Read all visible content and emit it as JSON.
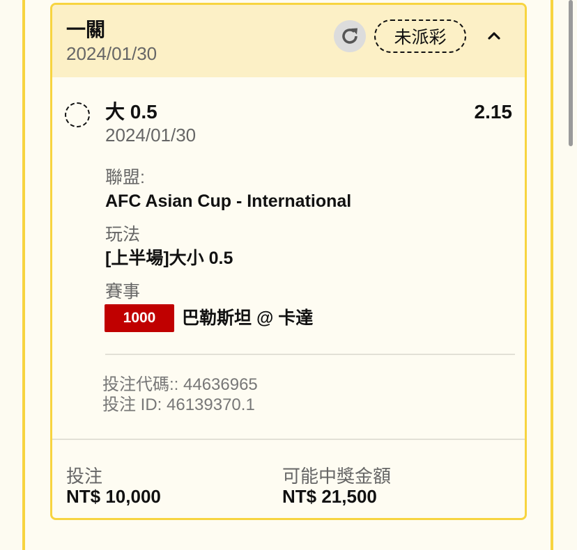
{
  "header": {
    "title": "一關",
    "date": "2024/01/30",
    "status": "未派彩",
    "refresh_icon": "refresh-icon",
    "collapse_icon": "chevron-up-icon"
  },
  "selection": {
    "title": "大 0.5",
    "odds": "2.15",
    "date": "2024/01/30"
  },
  "details": {
    "league_label": "聯盟:",
    "league_value": "AFC Asian Cup - International",
    "market_label": "玩法",
    "market_value": "[上半場]大小 0.5",
    "match_label": "賽事",
    "match_code": "1000",
    "match_name": "巴勒斯坦 @ 卡達"
  },
  "meta": {
    "bet_code": "投注代碼:: 44636965",
    "bet_id": "投注 ID: 46139370.1"
  },
  "footer": {
    "stake_label": "投注",
    "stake_value": "NT$ 10,000",
    "payout_label": "可能中獎金額",
    "payout_value": "NT$ 21,500"
  },
  "colors": {
    "accent_border": "#f7d440",
    "header_bg": "#fcf0c6",
    "match_badge_bg": "#c00000"
  }
}
